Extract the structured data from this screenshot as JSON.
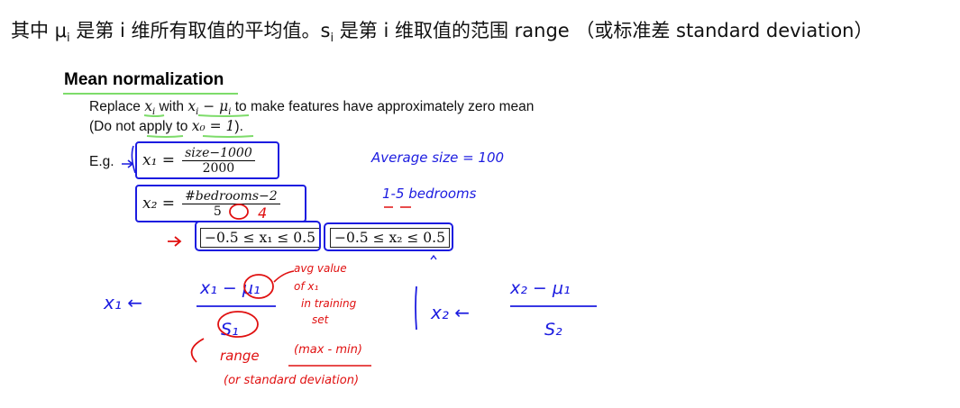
{
  "caption": {
    "part1": "其中 μ",
    "sub1": "i",
    "part2": " 是第 i 维所有取值的平均值。s",
    "sub2": "i",
    "part3": " 是第 i 维取值的范围 range （或标准差 standard deviation）"
  },
  "slide": {
    "title": "Mean normalization",
    "line1_a": "Replace ",
    "line1_xi": "x",
    "line1_b": " with ",
    "line1_expr": "x",
    "line1_c": " to make features have approximately zero mean",
    "line2_a": "(Do not apply to ",
    "line2_expr": "x₀ = 1",
    "line2_b": ").",
    "eg_label": "E.g.",
    "x1_lhs": "x₁ =",
    "x1_num": "size−1000",
    "x1_den": "2000",
    "x2_lhs": "x₂ =",
    "x2_num": "#bedrooms−2",
    "x2_den": "5",
    "ineq1": "−0.5 ≤ x₁ ≤ 0.5",
    "ineq2": "−0.5 ≤ x₂ ≤ 0.5"
  },
  "annotations": {
    "average_size": "Average size = 100",
    "bedrooms_range": "1-5 bedrooms",
    "replaced_den": "4",
    "x1_formula_lhs": "x₁ ←",
    "x1_formula_num": "x₁ − μ₁",
    "x1_formula_den": "S₁",
    "avg_value_note1": "avg value",
    "avg_value_note2": "of x₁",
    "avg_value_note3": "in training",
    "avg_value_note4": "set",
    "x2_formula_lhs": "x₂ ←",
    "x2_formula_num": "x₂ − μ₁",
    "x2_formula_den": "S₂",
    "range_note": "range",
    "maxmin_note": "(max - min)",
    "std_note": "(or standard deviation)"
  },
  "colors": {
    "ink_blue": "#1c1ce0",
    "ink_red": "#e01010",
    "ink_green": "#7ddc6a"
  }
}
